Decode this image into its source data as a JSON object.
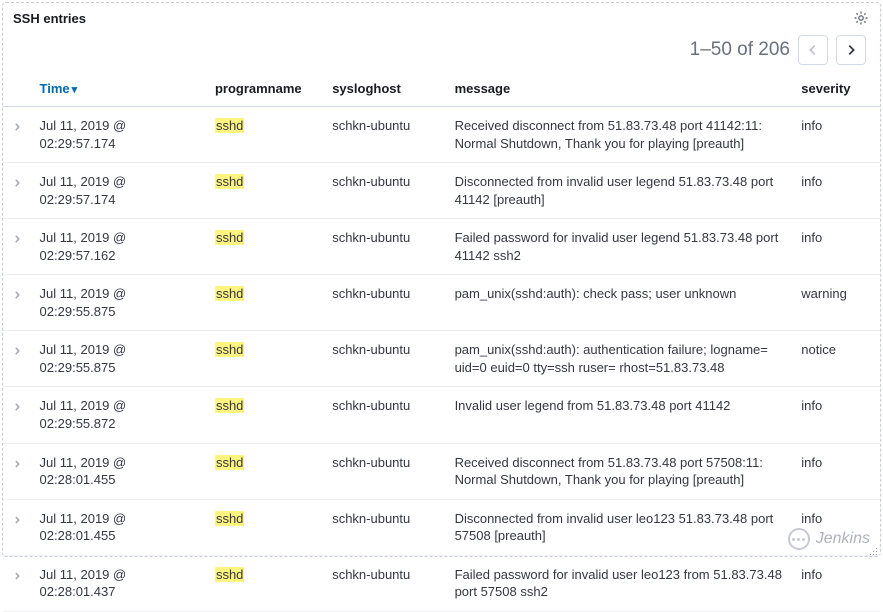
{
  "panel": {
    "title": "SSH entries"
  },
  "pager": {
    "range": "1–50 of 206"
  },
  "columns": {
    "time": "Time",
    "programname": "programname",
    "sysloghost": "sysloghost",
    "message": "message",
    "severity": "severity"
  },
  "highlight": "sshd",
  "rows": [
    {
      "time": "Jul 11, 2019 @ 02:29:57.174",
      "program": "sshd",
      "host": "schkn-ubuntu",
      "message": " Received disconnect from 51.83.73.48 port 41142:11: Normal Shutdown, Thank you for playing [preauth]",
      "severity": "info"
    },
    {
      "time": "Jul 11, 2019 @ 02:29:57.174",
      "program": "sshd",
      "host": "schkn-ubuntu",
      "message": " Disconnected from invalid user legend 51.83.73.48 port 41142 [preauth]",
      "severity": "info"
    },
    {
      "time": "Jul 11, 2019 @ 02:29:57.162",
      "program": "sshd",
      "host": "schkn-ubuntu",
      "message": " Failed password for invalid user legend 51.83.73.48 port 41142 ssh2",
      "severity": "info"
    },
    {
      "time": "Jul 11, 2019 @ 02:29:55.875",
      "program": "sshd",
      "host": "schkn-ubuntu",
      "message": "pam_unix(sshd:auth): check pass; user unknown",
      "severity": "warning"
    },
    {
      "time": "Jul 11, 2019 @ 02:29:55.875",
      "program": "sshd",
      "host": "schkn-ubuntu",
      "message": " pam_unix(sshd:auth): authentication failure; logname= uid=0 euid=0 tty=ssh ruser= rhost=51.83.73.48",
      "severity": "notice"
    },
    {
      "time": "Jul 11, 2019 @ 02:29:55.872",
      "program": "sshd",
      "host": "schkn-ubuntu",
      "message": "Invalid user legend from 51.83.73.48 port 41142",
      "severity": "info"
    },
    {
      "time": "Jul 11, 2019 @ 02:28:01.455",
      "program": "sshd",
      "host": "schkn-ubuntu",
      "message": " Received disconnect from 51.83.73.48 port 57508:11: Normal Shutdown, Thank you for playing [preauth]",
      "severity": "info"
    },
    {
      "time": "Jul 11, 2019 @ 02:28:01.455",
      "program": "sshd",
      "host": "schkn-ubuntu",
      "message": " Disconnected from invalid user leo123 51.83.73.48 port 57508 [preauth]",
      "severity": "info"
    },
    {
      "time": "Jul 11, 2019 @ 02:28:01.437",
      "program": "sshd",
      "host": "schkn-ubuntu",
      "message": " Failed password for invalid user leo123 from 51.83.73.48 port 57508 ssh2",
      "severity": "info"
    }
  ],
  "watermark": "Jenkins"
}
